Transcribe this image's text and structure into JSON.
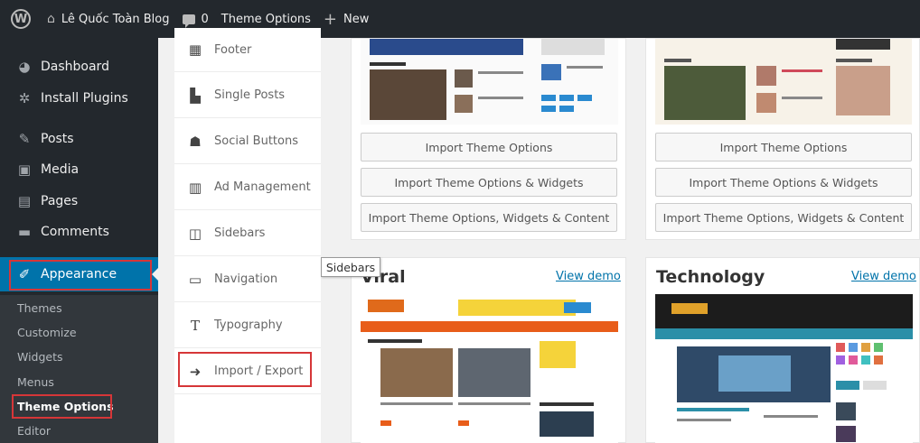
{
  "adminbar": {
    "site_name": "Lê Quốc Toàn Blog",
    "comments_count": "0",
    "theme_options": "Theme Options",
    "new_label": "New"
  },
  "menu": {
    "dashboard": "Dashboard",
    "install_plugins": "Install Plugins",
    "posts": "Posts",
    "media": "Media",
    "pages": "Pages",
    "comments": "Comments",
    "appearance": "Appearance",
    "submenu": [
      "Themes",
      "Customize",
      "Widgets",
      "Menus",
      "Theme Options",
      "Editor"
    ]
  },
  "options_panel": [
    "Footer",
    "Single Posts",
    "Social Buttons",
    "Ad Management",
    "Sidebars",
    "Navigation",
    "Typography",
    "Import / Export"
  ],
  "tooltip": "Sidebars",
  "buttons": {
    "import_options": "Import Theme Options",
    "import_widgets": "Import Theme Options & Widgets",
    "import_content": "Import Theme Options, Widgets & Content"
  },
  "demos": [
    {
      "title": "Viral",
      "view_demo": "View demo"
    },
    {
      "title": "Technology",
      "view_demo": "View demo"
    }
  ],
  "colors": {
    "adminbar": "#23282d",
    "accent": "#0073aa",
    "highlight_frame": "#d63638"
  }
}
